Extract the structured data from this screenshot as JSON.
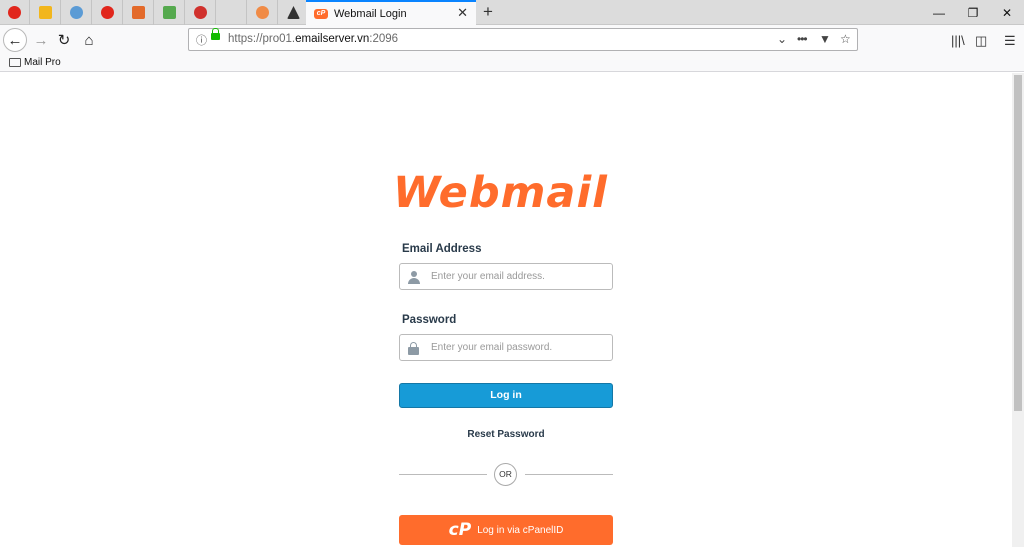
{
  "browser": {
    "pinned_tabs": [
      {
        "icon": "opera-icon",
        "color": "#e1261c"
      },
      {
        "icon": "shield-icon",
        "color": "#f2b61c"
      },
      {
        "icon": "plus-icon",
        "color": "#5b9bd5"
      },
      {
        "icon": "opera-icon",
        "color": "#e1261c"
      },
      {
        "icon": "pen-icon",
        "color": "#e36a2a"
      },
      {
        "icon": "image-icon",
        "color": "#55a94e"
      },
      {
        "icon": "pin-icon",
        "color": "#d0312d"
      },
      {
        "icon": "blank-icon",
        "color": "#dcdcdc"
      },
      {
        "icon": "x-circle-icon",
        "color": "#f08b46"
      },
      {
        "icon": "sail-icon",
        "color": "#333333"
      }
    ],
    "active_tab": {
      "title": "Webmail Login",
      "favicon": "cP"
    },
    "url_prefix": "https://pro01.",
    "url_domain": "emailserver.vn",
    "url_suffix": ":2096",
    "bookmark": "Mail Pro"
  },
  "page": {
    "logo": "Webmail",
    "email_label": "Email Address",
    "email_placeholder": "Enter your email address.",
    "password_label": "Password",
    "password_placeholder": "Enter your email password.",
    "login_button": "Log in",
    "reset_link": "Reset Password",
    "or_text": "OR",
    "cpanelid_button": "Log in via cPanelID",
    "cpanelid_icon": "cP"
  },
  "colors": {
    "brand": "#ff6c2c",
    "login": "#179bd7",
    "text": "#293a4a"
  }
}
